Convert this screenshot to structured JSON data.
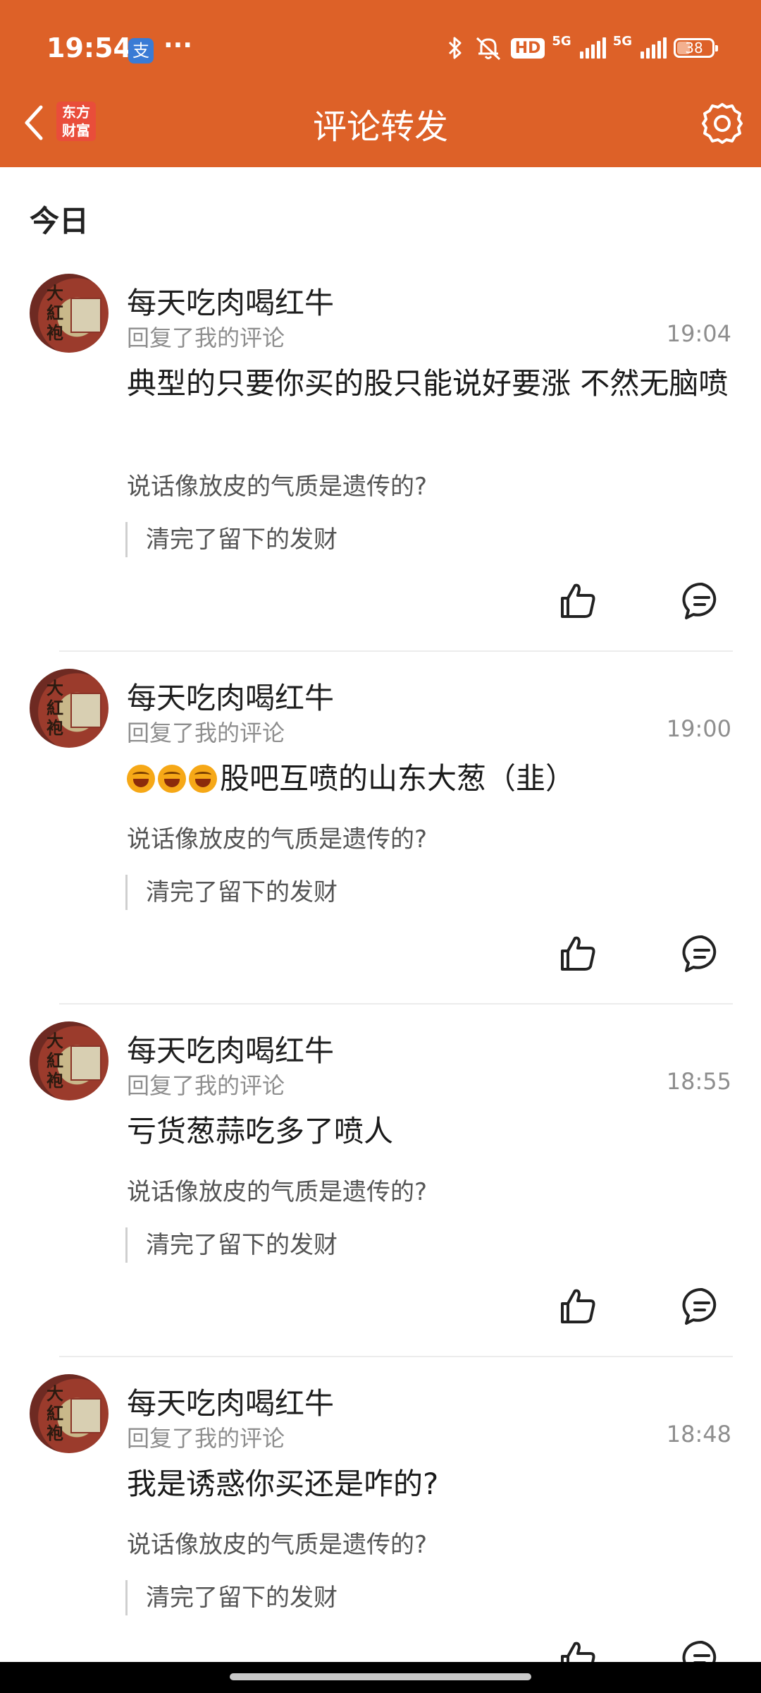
{
  "status_bar": {
    "time": "19:54",
    "alipay_icon": "支",
    "more": "···",
    "hd": "HD",
    "network_1": "5G",
    "network_2": "5G",
    "battery": "38",
    "battery_level_percent": 38
  },
  "nav": {
    "logo_line1": "东方",
    "logo_line2": "财富",
    "title": "评论转发"
  },
  "section": {
    "title": "今日"
  },
  "items": [
    {
      "username": "每天吃肉喝红牛",
      "action": "回复了我的评论",
      "time": "19:04",
      "content": "典型的只要你买的股只能说好要涨 不然无脑喷",
      "original": "说话像放皮的气质是遗传的?",
      "quote": "清完了留下的发财"
    },
    {
      "username": "每天吃肉喝红牛",
      "action": "回复了我的评论",
      "time": "19:00",
      "content": "股吧互喷的山东大葱（韭）",
      "original": "说话像放皮的气质是遗传的?",
      "quote": "清完了留下的发财"
    },
    {
      "username": "每天吃肉喝红牛",
      "action": "回复了我的评论",
      "time": "18:55",
      "content": "亏货葱蒜吃多了喷人",
      "original": "说话像放皮的气质是遗传的?",
      "quote": "清完了留下的发财"
    },
    {
      "username": "每天吃肉喝红牛",
      "action": "回复了我的评论",
      "time": "18:48",
      "content": "我是诱惑你买还是咋的?",
      "original": "说话像放皮的气质是遗传的?",
      "quote": "清完了留下的发财"
    }
  ],
  "avatar_text": "大紅袍",
  "icons": {
    "back": "chevron-left-icon",
    "settings": "gear-icon",
    "like": "thumbs-up-icon",
    "reply": "comment-icon"
  },
  "colors": {
    "header": "#DD6128",
    "text_primary": "#1f1f1f",
    "text_secondary": "#8e8e8e"
  }
}
